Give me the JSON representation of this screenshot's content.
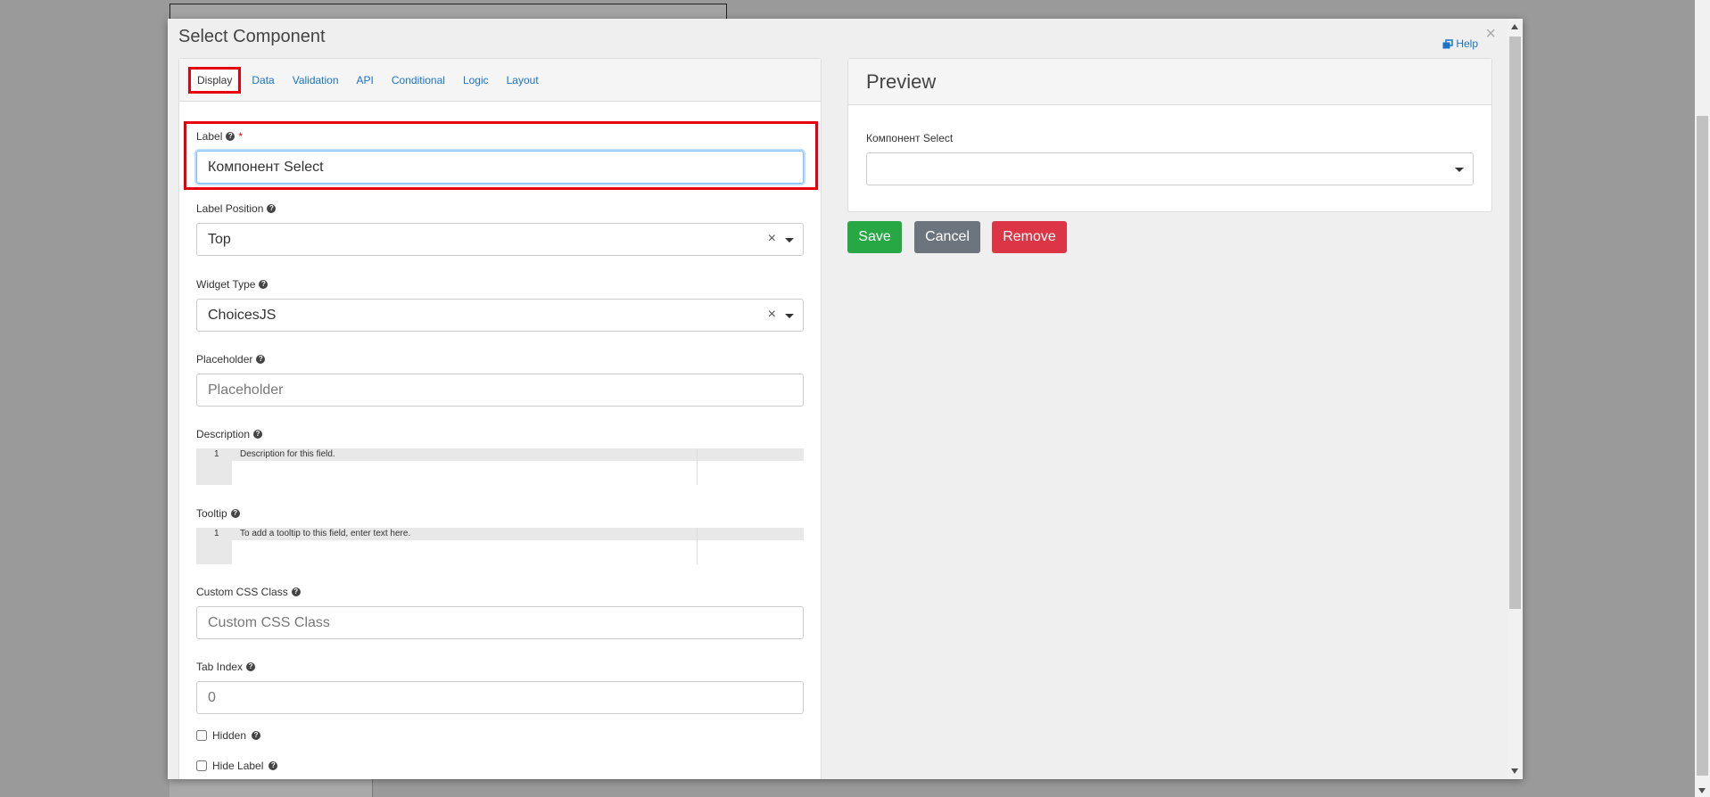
{
  "modal": {
    "title": "Select Component",
    "help_label": "Help",
    "close_symbol": "×"
  },
  "tabs": [
    {
      "label": "Display"
    },
    {
      "label": "Data"
    },
    {
      "label": "Validation"
    },
    {
      "label": "API"
    },
    {
      "label": "Conditional"
    },
    {
      "label": "Logic"
    },
    {
      "label": "Layout"
    }
  ],
  "fields": {
    "label": {
      "label": "Label",
      "value": "Компонент Select",
      "required_mark": "*"
    },
    "label_position": {
      "label": "Label Position",
      "value": "Top",
      "clear": "×"
    },
    "widget_type": {
      "label": "Widget Type",
      "value": "ChoicesJS",
      "clear": "×"
    },
    "placeholder": {
      "label": "Placeholder",
      "placeholder": "Placeholder"
    },
    "description": {
      "label": "Description",
      "line_number": "1",
      "placeholder": "Description for this field."
    },
    "tooltip": {
      "label": "Tooltip",
      "line_number": "1",
      "placeholder": "To add a tooltip to this field, enter text here."
    },
    "custom_css": {
      "label": "Custom CSS Class",
      "placeholder": "Custom CSS Class"
    },
    "tab_index": {
      "label": "Tab Index",
      "placeholder": "0"
    },
    "hidden": {
      "label": "Hidden",
      "checked": false
    },
    "hide_label": {
      "label": "Hide Label",
      "checked": false
    }
  },
  "preview": {
    "heading": "Preview",
    "field_label": "Компонент Select"
  },
  "buttons": {
    "save": "Save",
    "cancel": "Cancel",
    "remove": "Remove"
  },
  "colors": {
    "highlight": "#e6000f",
    "link": "#1a73c8",
    "save": "#28a745",
    "cancel": "#6c757d",
    "remove": "#dc3545"
  },
  "icons": {
    "question": "question-circle-icon",
    "help": "external-window-icon",
    "close": "close-icon",
    "dropdown": "caret-down-icon"
  }
}
